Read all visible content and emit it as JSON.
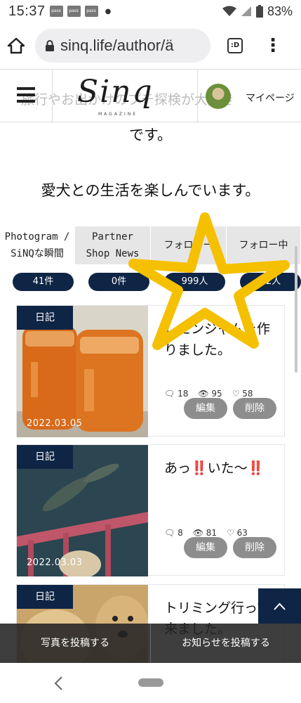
{
  "status": {
    "time": "15:37",
    "battery": "83%",
    "pass_label": "pass"
  },
  "browser": {
    "url": "sinq.life/author/ä",
    "tab_label": ":D"
  },
  "site": {
    "marquee": "旅行やお出かけのプチ探検が大好き",
    "logo": "Sinq",
    "logo_sub": "MAGAZINE",
    "mypage": "マイページ"
  },
  "profile": {
    "line1": "です。",
    "line2": "愛犬との生活を楽しんでいます。"
  },
  "tabs": [
    {
      "line1": "Photogram /",
      "line2": "SiNQな瞬間"
    },
    {
      "line1": "Partner",
      "line2": "Shop News"
    },
    {
      "line1": "フォロワー",
      "line2": ""
    },
    {
      "line1": "フォロー中",
      "line2": ""
    }
  ],
  "counts": [
    "41件",
    "0件",
    "999人",
    "82人"
  ],
  "posts": [
    {
      "category": "日記",
      "date": "2022.03.05",
      "title": "レモンジャムを作りました。",
      "comments": "18",
      "views": "95",
      "likes": "58",
      "edit": "編集",
      "delete": "削除"
    },
    {
      "category": "日記",
      "date": "2022.03.03",
      "title": "あっ‼️いた〜‼️",
      "comments": "8",
      "views": "81",
      "likes": "63",
      "edit": "編集",
      "delete": "削除"
    },
    {
      "category": "日記",
      "title": "トリミング行って来ました。"
    }
  ],
  "bottom_actions": {
    "post_photo": "写真を投稿する",
    "post_news": "お知らせを投稿する"
  },
  "colors": {
    "navy": "#0f2545",
    "star": "#f5c000",
    "button_gray": "#8d8d8d"
  }
}
